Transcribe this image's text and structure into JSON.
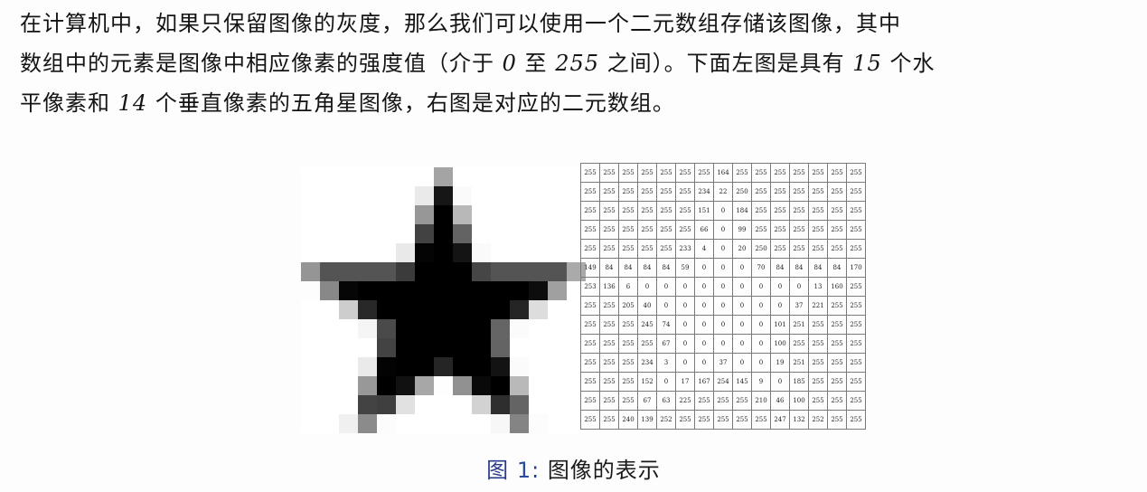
{
  "paragraph": {
    "line1": "在计算机中，如果只保留图像的灰度，那么我们可以使用一个二元数组存储该图像，其中",
    "line2_a": "数组中的元素是图像中相应像素的强度值（介于 ",
    "line2_n1": "0",
    "line2_b": " 至 ",
    "line2_n2": "255",
    "line2_c": " 之间）。下面左图是具有 ",
    "line2_n3": "15",
    "line2_d": " 个水",
    "line3_a": "平像素和 ",
    "line3_n1": "14",
    "line3_b": " 个垂直像素的五角星图像，右图是对应的二元数组。"
  },
  "caption": {
    "prefix": "图 ",
    "number": "1",
    "separator": ": ",
    "text": "图像的表示"
  },
  "pixel_array": [
    [
      255,
      255,
      255,
      255,
      255,
      255,
      255,
      164,
      255,
      255,
      255,
      255,
      255,
      255,
      255
    ],
    [
      255,
      255,
      255,
      255,
      255,
      255,
      234,
      22,
      250,
      255,
      255,
      255,
      255,
      255,
      255
    ],
    [
      255,
      255,
      255,
      255,
      255,
      255,
      151,
      0,
      184,
      255,
      255,
      255,
      255,
      255,
      255
    ],
    [
      255,
      255,
      255,
      255,
      255,
      255,
      66,
      0,
      99,
      255,
      255,
      255,
      255,
      255,
      255
    ],
    [
      255,
      255,
      255,
      255,
      255,
      233,
      4,
      0,
      20,
      250,
      255,
      255,
      255,
      255,
      255
    ],
    [
      149,
      84,
      84,
      84,
      84,
      59,
      0,
      0,
      0,
      70,
      84,
      84,
      84,
      84,
      170
    ],
    [
      253,
      136,
      6,
      0,
      0,
      0,
      0,
      0,
      0,
      0,
      0,
      0,
      13,
      160,
      255
    ],
    [
      255,
      255,
      205,
      40,
      0,
      0,
      0,
      0,
      0,
      0,
      0,
      37,
      221,
      255,
      255
    ],
    [
      255,
      255,
      255,
      245,
      74,
      0,
      0,
      0,
      0,
      0,
      101,
      251,
      255,
      255,
      255
    ],
    [
      255,
      255,
      255,
      255,
      67,
      0,
      0,
      0,
      0,
      0,
      100,
      255,
      255,
      255,
      255
    ],
    [
      255,
      255,
      255,
      234,
      3,
      0,
      0,
      37,
      0,
      0,
      19,
      251,
      255,
      255,
      255
    ],
    [
      255,
      255,
      255,
      152,
      0,
      17,
      167,
      254,
      145,
      9,
      0,
      185,
      255,
      255,
      255
    ],
    [
      255,
      255,
      255,
      67,
      63,
      225,
      255,
      255,
      255,
      210,
      46,
      100,
      255,
      255,
      255
    ],
    [
      255,
      255,
      240,
      139,
      252,
      255,
      255,
      255,
      255,
      255,
      247,
      132,
      252,
      255,
      255
    ]
  ]
}
